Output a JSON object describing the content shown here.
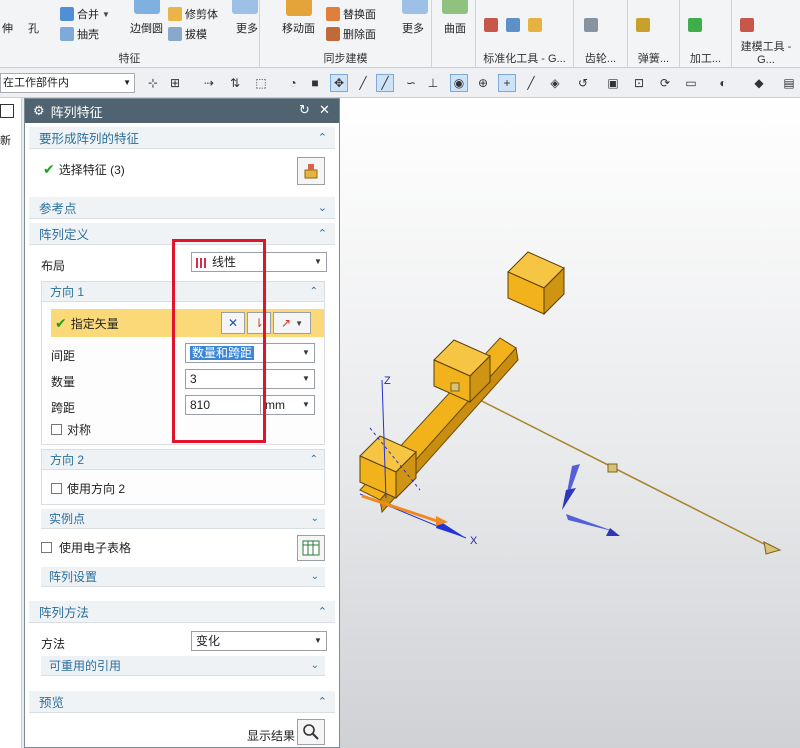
{
  "ribbon": {
    "group_feature": {
      "title": "特征",
      "btn_stretch": "伸",
      "btn_hole": "孔",
      "btn_unite": "合并",
      "btn_shell": "抽壳",
      "btn_edge_blend": "边倒圆",
      "btn_trim_body": "修剪体",
      "btn_draft": "拔模",
      "btn_more": "更多"
    },
    "group_sync": {
      "title": "同步建模",
      "btn_move_face": "移动面",
      "btn_replace_face": "替换面",
      "btn_delete_face": "删除面",
      "btn_more": "更多"
    },
    "group_curve": {
      "btn_curve": "曲面"
    },
    "tab_standard": "标准化工具 - G...",
    "tab_gear": "齿轮...",
    "tab_spring": "弹簧...",
    "tab_machining": "加工...",
    "tab_build": "建模工具 - G..."
  },
  "toolbar": {
    "scope": "在工作部件内"
  },
  "left_strip": {
    "label": "新"
  },
  "dialog": {
    "title": "阵列特征",
    "sections": {
      "features": {
        "title": "要形成阵列的特征",
        "select_label": "选择特征 (3)"
      },
      "reference_point": {
        "title": "参考点"
      },
      "pattern_definition": {
        "title": "阵列定义",
        "layout_label": "布局",
        "layout_value": "线性",
        "direction1": {
          "title": "方向 1",
          "vector_label": "指定矢量",
          "spacing_label": "间距",
          "spacing_value": "数量和跨距",
          "count_label": "数量",
          "count_value": "3",
          "span_label": "跨距",
          "span_value": "810",
          "span_unit": "mm",
          "symmetric_label": "对称"
        },
        "direction2": {
          "title": "方向 2",
          "use_label": "使用方向 2"
        },
        "instance_points": {
          "title": "实例点"
        },
        "use_spreadsheet_label": "使用电子表格",
        "pattern_settings": {
          "title": "阵列设置"
        }
      },
      "pattern_method": {
        "title": "阵列方法",
        "method_label": "方法",
        "method_value": "变化",
        "reusable_refs": "可重用的引用"
      },
      "preview": {
        "title": "预览",
        "show_result": "显示结果"
      }
    }
  },
  "viewport": {
    "axis_x": "X",
    "axis_z": "Z",
    "colors": {
      "body": "#f2b21b",
      "vector": "#a9822a",
      "csys": "#2433d6"
    }
  }
}
